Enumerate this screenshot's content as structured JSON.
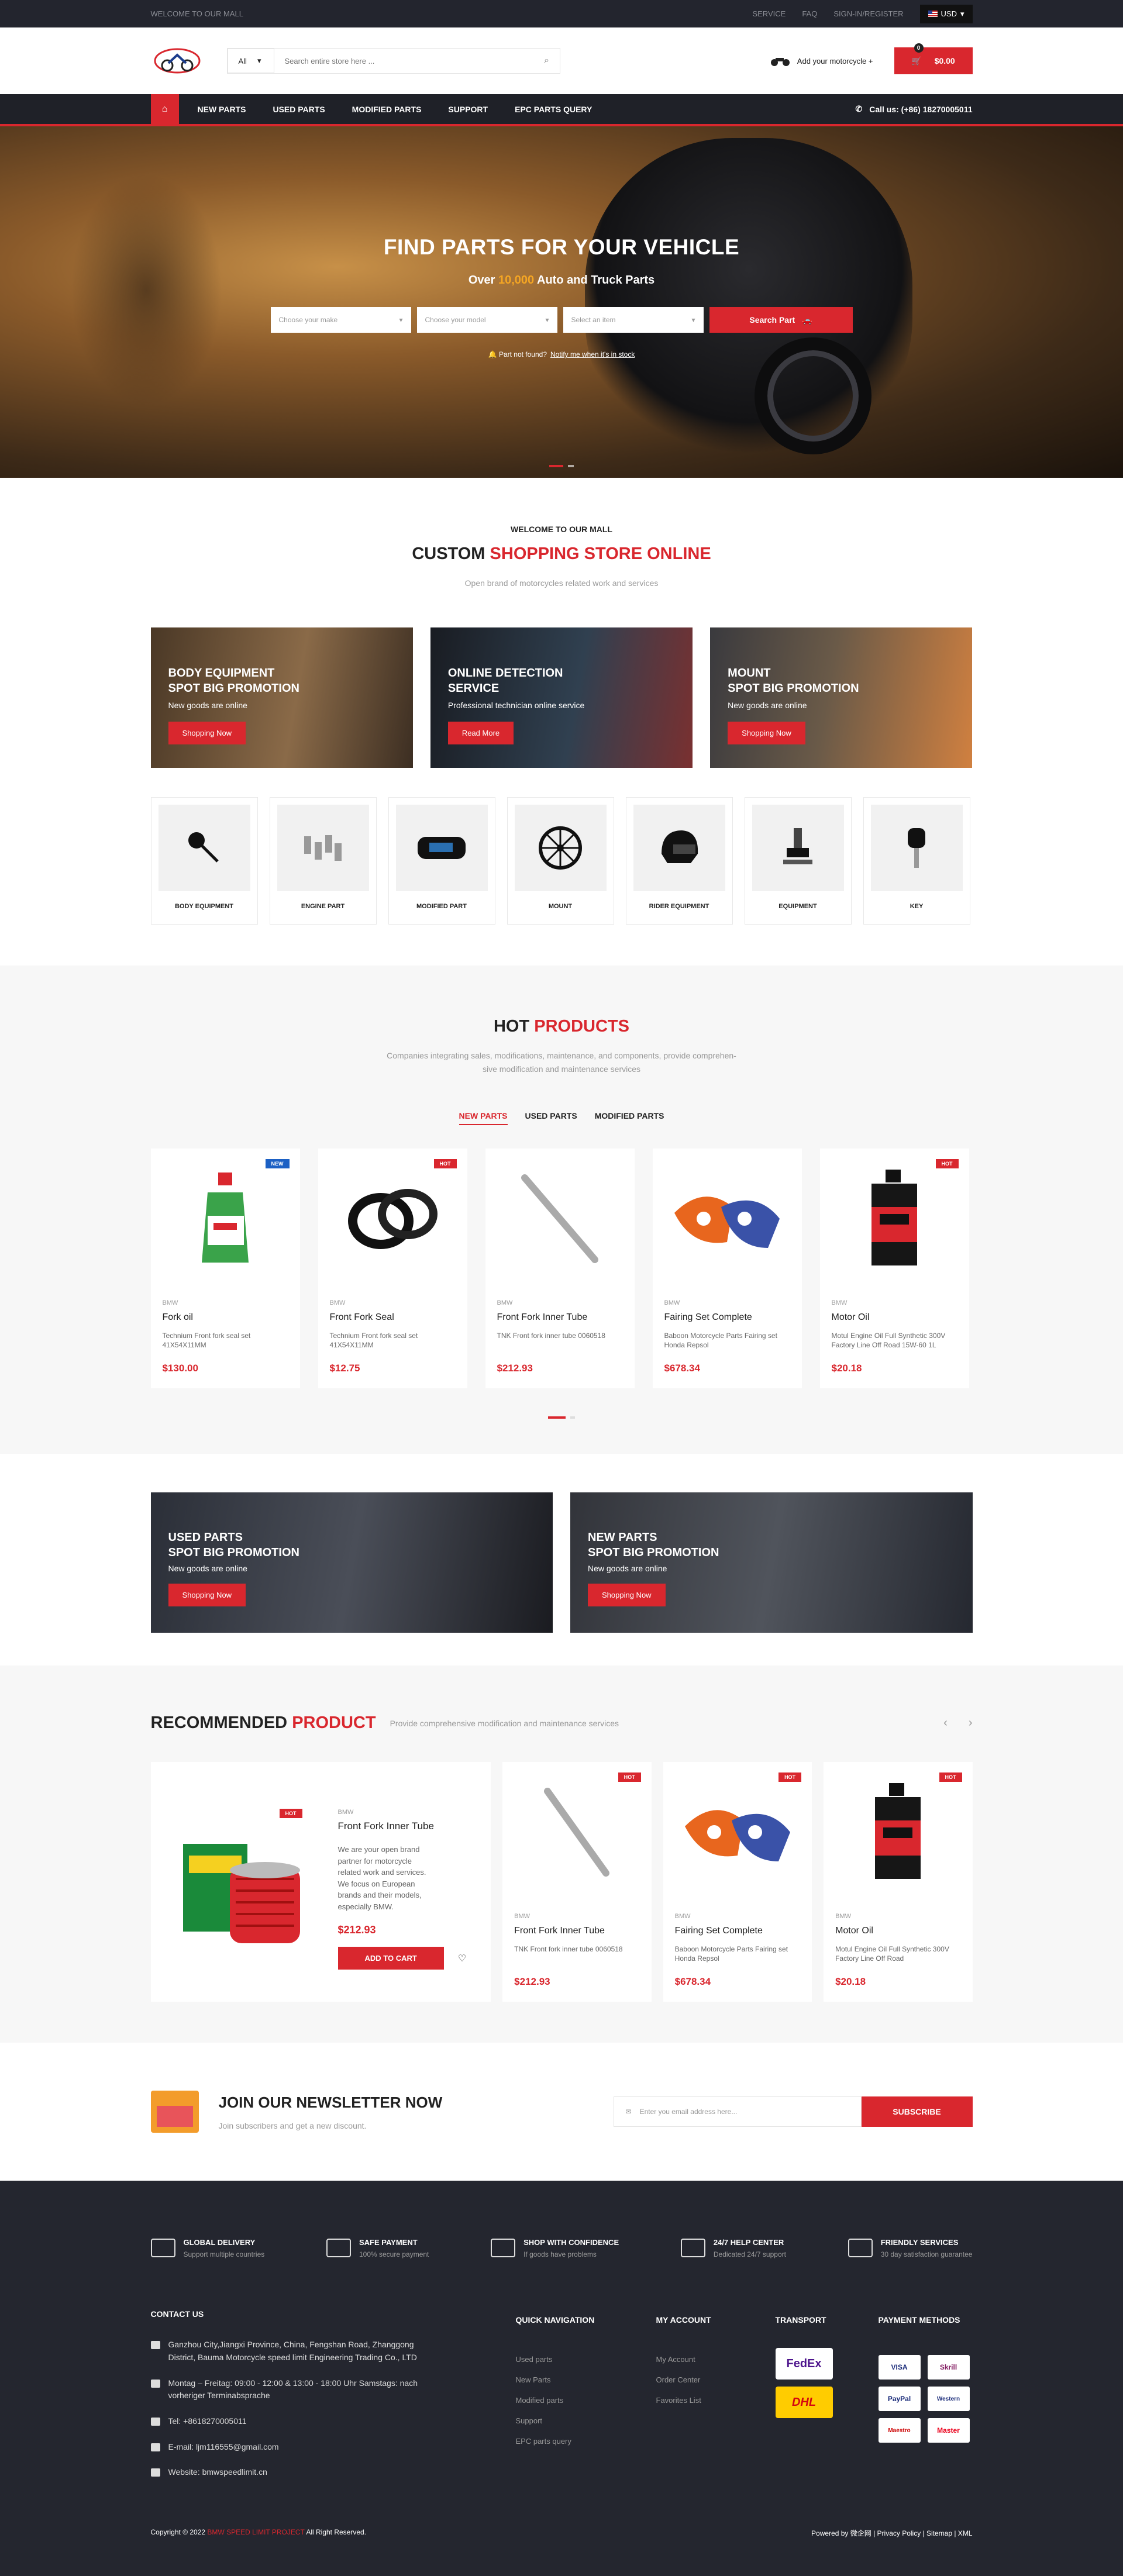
{
  "topbar": {
    "welcome": "WELCOME TO OUR MALL",
    "links": [
      "SERVICE",
      "FAQ",
      "SIGN-IN/REGISTER"
    ],
    "currency": "USD"
  },
  "header": {
    "category": "All",
    "search_placeholder": "Search entire store here ...",
    "moto_label": "Add your motorcycle +",
    "cart_total": "$0.00",
    "cart_count": "0"
  },
  "nav": {
    "items": [
      "NEW PARTS",
      "USED PARTS",
      "MODIFIED PARTS",
      "SUPPORT",
      "EPC PARTS QUERY"
    ],
    "call": "Call us: (+86) 18270005011"
  },
  "hero": {
    "title": "FIND PARTS FOR YOUR VEHICLE",
    "sub_pre": "Over",
    "sub_num": "10,000",
    "sub_post": "Auto and Truck Parts",
    "make": "Choose your make",
    "model": "Choose your model",
    "item": "Select an item",
    "search": "Search Part",
    "notfound": "Part not found?",
    "notify": "Notify me when it's in stock"
  },
  "welcome": {
    "kicker": "WELCOME TO OUR MALL",
    "h_black": "CUSTOM",
    "h_red": "SHOPPING STORE ONLINE",
    "desc": "Open brand of motorcycles related work and services"
  },
  "promos": [
    {
      "t1": "BODY EQUIPMENT",
      "t2": "SPOT BIG PROMOTION",
      "s": "New goods are online",
      "b": "Shopping Now"
    },
    {
      "t1": "ONLINE DETECTION",
      "t2": "SERVICE",
      "s": "Professional technician online service",
      "b": "Read More"
    },
    {
      "t1": "MOUNT",
      "t2": "SPOT BIG PROMOTION",
      "s": "New goods are online",
      "b": "Shopping Now"
    }
  ],
  "categories": [
    "BODY EQUIPMENT",
    "ENGINE PART",
    "MODIFIED PART",
    "MOUNT",
    "RIDER EQUIPMENT",
    "EQUIPMENT",
    "KEY"
  ],
  "hot": {
    "h_black": "HOT",
    "h_red": "PRODUCTS",
    "desc1": "Companies integrating sales, modifications, maintenance, and components, provide comprehen-",
    "desc2": "sive modification and maintenance services",
    "tabs": [
      "NEW PARTS",
      "USED PARTS",
      "MODIFIED PARTS"
    ],
    "products": [
      {
        "badge": "NEW",
        "brand": "BMW",
        "name": "Fork oil",
        "desc": "Technium Front fork seal set 41X54X11MM",
        "price": "$130.00"
      },
      {
        "badge": "HOT",
        "brand": "BMW",
        "name": "Front Fork Seal",
        "desc": "Technium Front fork seal set 41X54X11MM",
        "price": "$12.75"
      },
      {
        "badge": "",
        "brand": "BMW",
        "name": "Front Fork Inner Tube",
        "desc": "TNK Front fork inner tube 0060518",
        "price": "$212.93"
      },
      {
        "badge": "",
        "brand": "BMW",
        "name": "Fairing Set Complete",
        "desc": "Baboon Motorcycle Parts Fairing set Honda Repsol",
        "price": "$678.34"
      },
      {
        "badge": "HOT",
        "brand": "BMW",
        "name": "Motor Oil",
        "desc": "Motul Engine Oil Full Synthetic 300V Factory Line Off Road 15W-60 1L",
        "price": "$20.18"
      }
    ]
  },
  "banners": [
    {
      "t1": "USED PARTS",
      "t2": "SPOT BIG PROMOTION",
      "s": "New goods are online",
      "b": "Shopping Now"
    },
    {
      "t1": "NEW PARTS",
      "t2": "SPOT BIG PROMOTION",
      "s": "New goods are online",
      "b": "Shopping Now"
    }
  ],
  "rec": {
    "h_black": "RECOMMENDED",
    "h_red": "PRODUCT",
    "desc": "Provide comprehensive modification and maintenance services",
    "big": {
      "badge": "HOT",
      "brand": "BMW",
      "name": "Front Fork Inner Tube",
      "desc": "We are your open brand partner for motorcycle related work and services. We focus on European brands and their models, especially BMW.",
      "price": "$212.93",
      "add": "ADD TO CART"
    },
    "products": [
      {
        "badge": "HOT",
        "brand": "BMW",
        "name": "Front Fork Inner Tube",
        "desc": "TNK Front fork inner tube 0060518",
        "price": "$212.93"
      },
      {
        "badge": "HOT",
        "brand": "BMW",
        "name": "Fairing Set Complete",
        "desc": "Baboon Motorcycle Parts Fairing set Honda Repsol",
        "price": "$678.34"
      },
      {
        "badge": "HOT",
        "brand": "BMW",
        "name": "Motor Oil",
        "desc": "Motul Engine Oil Full Synthetic 300V Factory Line Off Road",
        "price": "$20.18"
      }
    ]
  },
  "newsletter": {
    "title": "JOIN OUR NEWSLETTER NOW",
    "desc": "Join subscribers and get a new discount.",
    "placeholder": "Enter you email address here...",
    "button": "SUBSCRIBE"
  },
  "features": [
    {
      "t": "GLOBAL DELIVERY",
      "d": "Support multiple countries"
    },
    {
      "t": "SAFE PAYMENT",
      "d": "100% secure payment"
    },
    {
      "t": "SHOP WITH CONFIDENCE",
      "d": "If goods have problems"
    },
    {
      "t": "24/7 HELP CENTER",
      "d": "Dedicated 24/7 support"
    },
    {
      "t": "FRIENDLY SERVICES",
      "d": "30 day satisfaction guarantee"
    }
  ],
  "footer": {
    "contact_h": "CONTACT US",
    "address": "Ganzhou City,Jiangxi Province, China, Fengshan Road, Zhanggong District, Bauma Motorcycle speed limit Engineering Trading Co., LTD",
    "hours": "Montag – Freitag: 09:00 - 12:00 & 13:00 - 18:00 Uhr Samstags: nach vorheriger Terminabsprache",
    "tel": "Tel: +8618270005011",
    "email": "E-mail: ljm116555@gmail.com",
    "website": "Website: bmwspeedlimit.cn",
    "qn_h": "QUICK NAVIGATION",
    "qn": [
      "Used parts",
      "New Parts",
      "Modified parts",
      "Support",
      "EPC parts query"
    ],
    "ma_h": "MY ACCOUNT",
    "ma": [
      "My Account",
      "Order Center",
      "Favorites List"
    ],
    "tr_h": "TRANSPORT",
    "tr": [
      "FedEx",
      "DHL"
    ],
    "pm_h": "PAYMENT METHODS",
    "pm": [
      "VISA",
      "Skrill",
      "PayPal",
      "Western",
      "Maestro",
      "Master"
    ],
    "copy_pre": "Copyright © 2022",
    "copy_red": "BMW SPEED LIMIT PROJECT",
    "copy_post": "All Right Reserved.",
    "right": "Powered by 微企网 | Privacy Policy | Sitemap | XML"
  }
}
